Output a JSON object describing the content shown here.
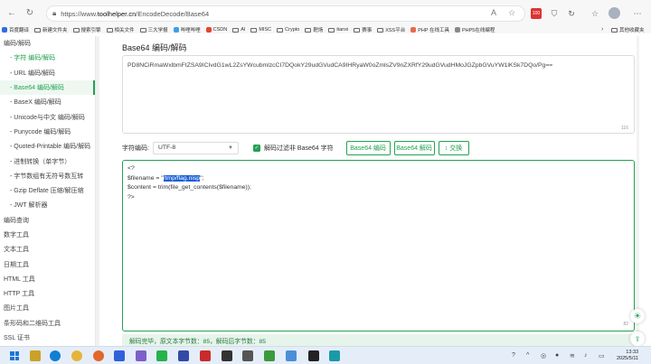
{
  "browser": {
    "url_prefix": "https://www.",
    "url_domain": "toolhelper.cn",
    "url_path": "/EncodeDecode/Base64",
    "badge_count": "100"
  },
  "bookmarks": [
    "百度翻译",
    "新建文件夹",
    "搜索引擎",
    "相关文件",
    "三大学报",
    "哔哩哔哩",
    "CSDN",
    "AI",
    "MISC",
    "Crypto",
    "靶场",
    "tianxi",
    "赛事",
    "XSS平台",
    "PHP 在线工具",
    "PHP5在线编程",
    "其他收藏夹"
  ],
  "sidebar": {
    "items": [
      {
        "label": "编码/解码",
        "kind": "top"
      },
      {
        "label": "- 字符 编码/解码",
        "kind": "green"
      },
      {
        "label": "- URL 编码/解码",
        "kind": "sub"
      },
      {
        "label": "- Base64 编码/解码",
        "kind": "active"
      },
      {
        "label": "- BaseX 编码/解码",
        "kind": "sub"
      },
      {
        "label": "- Unicode与中文 编码/解码",
        "kind": "sub"
      },
      {
        "label": "- Punycode 编码/解码",
        "kind": "sub"
      },
      {
        "label": "- Quoted-Printable 编码/解码",
        "kind": "sub"
      },
      {
        "label": "- 进制转换（单字节）",
        "kind": "sub"
      },
      {
        "label": "- 字节数组有无符号数互转",
        "kind": "sub"
      },
      {
        "label": "- Gzip Deflate 压缩/解压缩",
        "kind": "sub"
      },
      {
        "label": "- JWT 解析器",
        "kind": "sub"
      },
      {
        "label": "编码查询",
        "kind": "top"
      },
      {
        "label": "数字工具",
        "kind": "top"
      },
      {
        "label": "文本工具",
        "kind": "top"
      },
      {
        "label": "日期工具",
        "kind": "top"
      },
      {
        "label": "HTML 工具",
        "kind": "top"
      },
      {
        "label": "HTTP 工具",
        "kind": "top"
      },
      {
        "label": "图片工具",
        "kind": "top"
      },
      {
        "label": "条形码和二维码工具",
        "kind": "top"
      },
      {
        "label": "SSL 证书",
        "kind": "top"
      }
    ]
  },
  "main": {
    "title": "Base64 编码/解码",
    "input_text": "PD8NCiRmaWxlbmFtZSA9ICIvdG1wL2ZsYWcubmlzcCI7DQokY29udGVudCA9IHRyaW0oZmlsZV9nZXRfY29udGVudHMoJGZpbGVuYW1lKSk7DQo/Pg==",
    "input_count": "116",
    "charset_label": "字符编码:",
    "charset_value": "UTF-8",
    "filter_label": "解码过滤非 Base64 字符",
    "encode_label": "Base64 编码",
    "decode_label": "Base64 解码",
    "swap_label": "↕ 交换",
    "output": {
      "line1": "<?",
      "line2_pre": "$filename = \"",
      "line2_sel": "/tmp/flag.nisp",
      "line2_post": "\";",
      "line3": "$content = trim(file_get_contents($filename));",
      "line4": "?>"
    },
    "output_count": "82",
    "status": "解码完毕，原文本字节数：85，解码后字节数：85"
  },
  "taskbar": {
    "time": "13:33",
    "date": "2025/5/11"
  },
  "colors": {
    "accent": "#23a152",
    "selection": "#1a5fd6"
  }
}
